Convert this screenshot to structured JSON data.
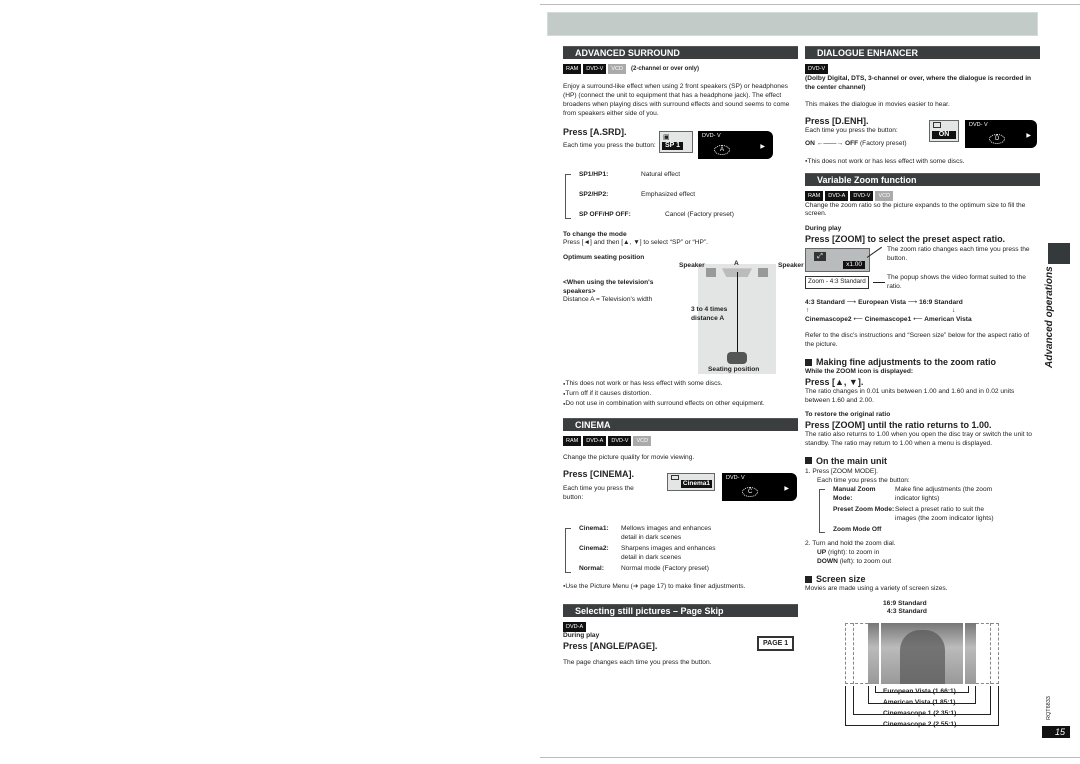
{
  "page": {
    "side_label": "Advanced operations",
    "doc_code": "RQT6833",
    "page_number": "15"
  },
  "advanced_surround": {
    "title": "ADVANCED SURROUND",
    "tags": [
      "RAM",
      "DVD-V",
      "VCD"
    ],
    "tag_note": "(2-channel or over only)",
    "intro": "Enjoy a surround-like effect when using 2 front speakers (SP) or headphones (HP) (connect the unit to equipment that has a headphone jack). The effect broadens when playing discs with surround effects and sound seems to come from speakers either side of you.",
    "press": "Press [A.SRD].",
    "each_time": "Each time you press the button:",
    "osd_value": "SP 1",
    "screen_label": "DVD- V",
    "screen_badge": "A",
    "modes": [
      {
        "key": "SP1/HP1:",
        "desc": "Natural effect"
      },
      {
        "key": "SP2/HP2:",
        "desc": "Emphasized effect"
      },
      {
        "key": "SP OFF/HP OFF:",
        "desc": "Cancel (Factory preset)"
      }
    ],
    "change_mode_title": "To change the mode",
    "change_mode_text": "Press [◄] and then [▲, ▼] to select “SP” or “HP”.",
    "seating_title": "Optimum seating position",
    "tv_speakers_title": "<When using the television's speakers>",
    "tv_speakers_text": "Distance A = Television's width",
    "diagram": {
      "speaker_left": "Speaker",
      "speaker_right": "Speaker",
      "distance_label": "A",
      "distance_text": "3 to 4 times distance A",
      "seat_label": "Seating position"
    },
    "notes": [
      "This does not work or has less effect with some discs.",
      "Turn off if it causes distortion.",
      "Do not use in combination with surround effects on other equipment."
    ]
  },
  "cinema": {
    "title": "CINEMA",
    "tags": [
      "RAM",
      "DVD-A",
      "DVD-V",
      "VCD"
    ],
    "intro": "Change the picture quality for movie viewing.",
    "press": "Press [CINEMA].",
    "each_time": "Each time you press the button:",
    "osd_value": "Cinema1",
    "screen_label": "DVD- V",
    "screen_badge": "C",
    "modes": [
      {
        "key": "Cinema1:",
        "desc": "Mellows images and enhances detail in dark scenes"
      },
      {
        "key": "Cinema2:",
        "desc": "Sharpens images and enhances detail in dark scenes"
      },
      {
        "key": "Normal:",
        "desc": "Normal mode (Factory preset)"
      }
    ],
    "note": "Use the Picture Menu (➔ page 17) to make finer adjustments."
  },
  "page_skip": {
    "title": "Selecting still pictures – Page Skip",
    "tags": [
      "DVD-A"
    ],
    "during_play": "During play",
    "press": "Press [ANGLE/PAGE].",
    "osd_value": "PAGE 1",
    "text": "The page changes each time you press the button."
  },
  "dialogue_enhancer": {
    "title": "DIALOGUE ENHANCER",
    "tags": [
      "DVD-V"
    ],
    "tag_note": "(Dolby Digital, DTS, 3-channel or over, where the dialogue is recorded in the center channel)",
    "intro": "This makes the dialogue in movies easier to hear.",
    "press": "Press [D.ENH].",
    "each_time": "Each time you press the button:",
    "toggle_on": "ON",
    "toggle_arrow": "←——→",
    "toggle_off": "OFF",
    "toggle_off_note": "(Factory preset)",
    "osd_value": "ON",
    "screen_label": "DVD- V",
    "screen_badge": "D",
    "note": "This does not work or has less effect with some discs."
  },
  "variable_zoom": {
    "title": "Variable Zoom function",
    "tags": [
      "RAM",
      "DVD-A",
      "DVD-V",
      "VCD"
    ],
    "intro": "Change the zoom ratio so the picture expands to the optimum size to fill the screen.",
    "during_play": "During play",
    "press": "Press [ZOOM] to select the preset aspect ratio.",
    "osd_ratio": "x1.00",
    "osd_popup": "Zoom - 4:3 Standard",
    "callout_1": "The zoom ratio changes each time you press the button.",
    "callout_2": "The popup shows the video format suited to the ratio.",
    "cycle_row1": [
      "4:3 Standard",
      "European Vista",
      "16:9 Standard"
    ],
    "cycle_row2": [
      "Cinemascope2",
      "Cinemascope1",
      "American Vista"
    ],
    "refer": "Refer to the disc's instructions and “Screen size” below for the aspect ratio of the picture.",
    "fine": {
      "title": "Making fine adjustments to the zoom ratio",
      "while": "While the ZOOM icon is displayed:",
      "press": "Press [▲, ▼].",
      "text": "The ratio changes in 0.01 units between 1.00 and 1.60 and in 0.02 units between 1.60 and 2.00.",
      "restore_title": "To restore the original ratio",
      "restore_press": "Press [ZOOM] until the ratio returns to 1.00.",
      "restore_text": "The ratio also returns to 1.00 when you open the disc tray or switch the unit to standby. The ratio may return to 1.00 when a menu is displayed."
    },
    "main_unit": {
      "title": "On the main unit",
      "step1": "1.  Press [ZOOM MODE].",
      "step1_sub": "Each time you press the button:",
      "modes": [
        {
          "key": "Manual Zoom Mode:",
          "desc": "Make fine adjustments (the zoom indicator lights)"
        },
        {
          "key": "Preset Zoom Mode:",
          "desc": "Select a preset ratio to suit the images (the zoom indicator lights)"
        },
        {
          "key": "Zoom Mode Off",
          "desc": ""
        }
      ],
      "step2": "2.  Turn and hold the zoom dial.",
      "up_key": "UP",
      "up_text": "(right):    to zoom in",
      "down_key": "DOWN",
      "down_text": "(left): to zoom out"
    },
    "screen_size": {
      "title": "Screen size",
      "text": "Movies are made using a variety of screen sizes.",
      "labels_top": [
        "16:9 Standard",
        "4:3 Standard"
      ],
      "labels_bottom": [
        "European Vista (1.66:1)",
        "American Vista (1.85:1)",
        "Cinemascope 1 (2.35:1)",
        "Cinemascope 2 (2.55:1)"
      ]
    }
  }
}
